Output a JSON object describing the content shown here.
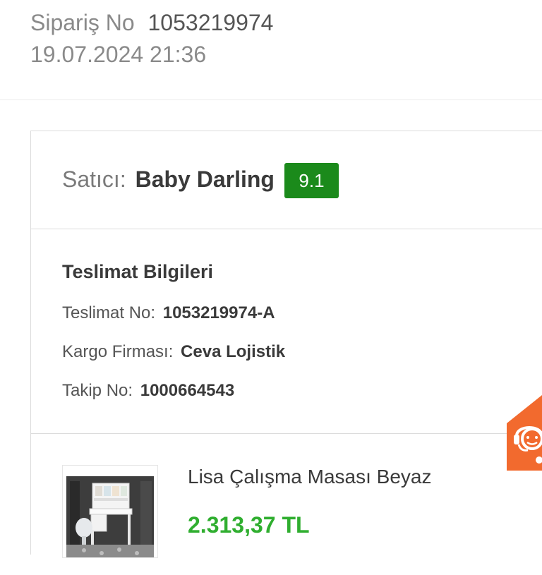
{
  "order": {
    "label": "Sipariş No",
    "number": "1053219974",
    "date": "19.07.2024 21:36"
  },
  "seller": {
    "label": "Satıcı:",
    "name": "Baby Darling",
    "rating": "9.1",
    "rating_color": "#1b8a1b"
  },
  "delivery": {
    "title": "Teslimat Bilgileri",
    "rows": [
      {
        "label": "Teslimat No:",
        "value": "1053219974-A"
      },
      {
        "label": "Kargo Firması:",
        "value": "Ceva Lojistik"
      },
      {
        "label": "Takip No:",
        "value": "1000664543"
      }
    ]
  },
  "product": {
    "name": "Lisa Çalışma Masası Beyaz",
    "price": "2.313,37 TL",
    "price_color": "#2fae2f",
    "image_icon": "desk-product-image"
  },
  "help_widget": {
    "icon": "support-agent-icon",
    "color": "#f26a2e"
  }
}
